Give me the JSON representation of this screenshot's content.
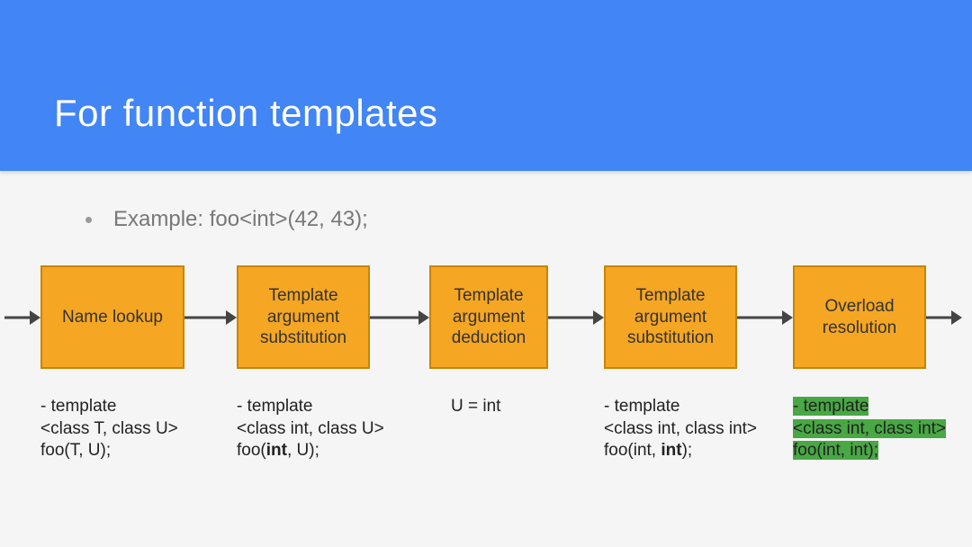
{
  "header": {
    "title": "For function templates"
  },
  "bullet": {
    "text": "Example: foo<int>(42, 43);"
  },
  "flow": {
    "boxes": [
      {
        "label": "Name lookup"
      },
      {
        "label": "Template\nargument\nsubstitution"
      },
      {
        "label": "Template\nargument\ndeduction"
      },
      {
        "label": "Template\nargument\nsubstitution"
      },
      {
        "label": "Overload\nresolution"
      }
    ]
  },
  "notes": {
    "n0": {
      "l1": "- template",
      "l2": "<class T, class U>",
      "l3a": "foo(T, U);"
    },
    "n1": {
      "l1": "- template",
      "l2": "<class int, class U>",
      "l3a": "foo(",
      "l3b": "int",
      "l3c": ", U);"
    },
    "n2": {
      "l1": "U = int"
    },
    "n3": {
      "l1": "- template",
      "l2": "<class int, class int>",
      "l3a": "foo(int, ",
      "l3b": "int",
      "l3c": ");"
    },
    "n4": {
      "l1": "- template",
      "l2": "<class int, class int>",
      "l3": "foo(int, int);"
    }
  }
}
